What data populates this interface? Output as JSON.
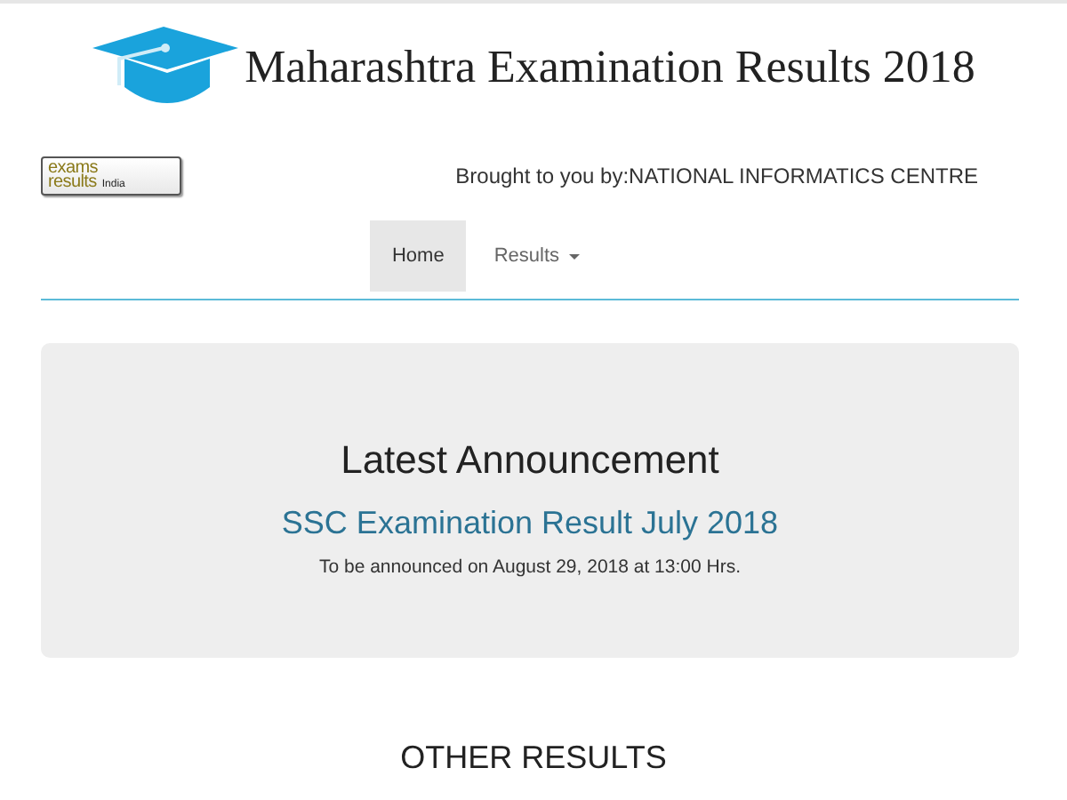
{
  "header": {
    "title": "Maharashtra Examination Results 2018"
  },
  "logo": {
    "word_1": "exams",
    "word_2": "results",
    "tag": "India"
  },
  "credit": "Brought to you by:NATIONAL INFORMATICS CENTRE",
  "nav": [
    {
      "label": "Home",
      "selected": true,
      "kind": "link"
    },
    {
      "label": "Results",
      "selected": false,
      "kind": "dropdown"
    }
  ],
  "announcement": {
    "heading": "Latest Announcement",
    "link": "SSC Examination Result July 2018",
    "note": "To be announced on August 29, 2018 at 13:00 Hrs."
  },
  "section_heading": "OTHER RESULTS"
}
